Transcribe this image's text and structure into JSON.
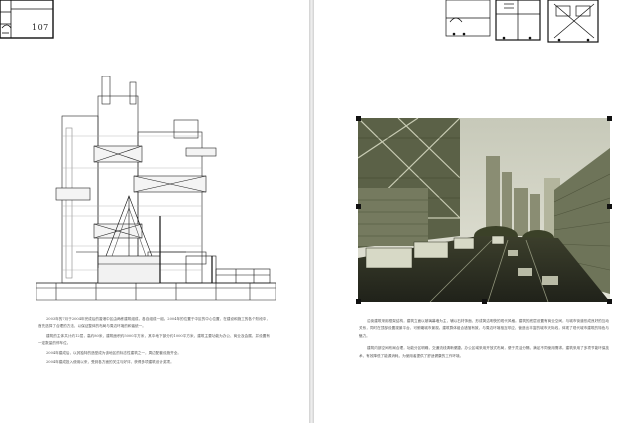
{
  "spread": {
    "left_page": {
      "page_number": "107",
      "paragraphs": [
        "2003年的7月于2004年完成后的香港中区由两栋建筑组成，各自组成一组。2004年的位置于中区的中心位置，在建设和施工的各个阶段中，首先选择了合理的方法，以保证整体的布局与周边环境的和谐统一。",
        "建筑的主体共计约12层，高约80米，建筑面积约5000平方米，其中地下部分约1000平方米，建筑主要功能为办公、商业及会展，并设置有一定数量的停车位。",
        "2004年建成后，以其独特的造型成为该地区的标志性建筑之一，周边配套设施齐全。",
        "2004年建成投入使用以来，受到各方面的关注与好评，获得多项建筑设计奖项。"
      ]
    },
    "right_page": {
      "paragraphs": [
        "沿街建筑采用框架结构，建筑立面以玻璃幕墙为主，辅以石材饰面，形成简洁明快的现代风格。建筑的底层设置有商业空间，与城市街道形成良好的互动关系，同时在顶部设置观景平台，可俯瞰城市景观。建筑群体组合错落有致，与周边环境相互呼应，营造出丰富的城市天际线，体现了现代城市建筑的特色与魅力。",
        "建筑内部空间布局合理，功能分区明确，交通流线清晰便捷。办公区域采用开放式布局，便于灵活分隔，满足不同使用需求。建筑采用了多项节能环保技术，有效降低了能源消耗，为使用者提供了舒适健康的工作环境。"
      ]
    }
  }
}
